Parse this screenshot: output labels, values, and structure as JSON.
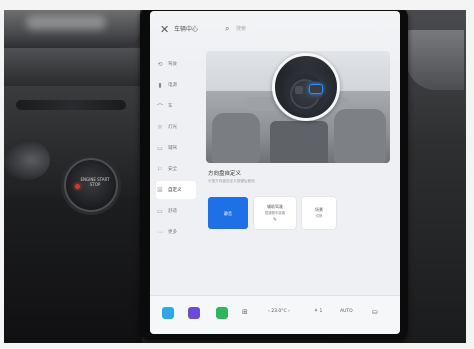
{
  "app": {
    "close_glyph": "✕",
    "title": "车辆中心",
    "search_glyph": "🔍",
    "search_label": "搜索"
  },
  "sidebar": {
    "items": [
      {
        "label": "驾驶",
        "icon": "steering-icon",
        "glyph": "⟲"
      },
      {
        "label": "电源",
        "icon": "battery-icon",
        "glyph": "▮"
      },
      {
        "label": "车",
        "icon": "car-icon",
        "glyph": "⌒"
      },
      {
        "label": "灯光",
        "icon": "light-icon",
        "glyph": "☼"
      },
      {
        "label": "辅驾",
        "icon": "assist-icon",
        "glyph": "▭"
      },
      {
        "label": "安全",
        "icon": "shield-icon",
        "glyph": "⚐"
      },
      {
        "label": "自定义",
        "icon": "custom-icon",
        "glyph": "☒"
      },
      {
        "label": "舒适",
        "icon": "comfort-icon",
        "glyph": "▭"
      },
      {
        "label": "更多",
        "icon": "more-icon",
        "glyph": "⋯"
      }
    ],
    "active_index": 6
  },
  "section": {
    "title": "方向盘自定义",
    "subtitle": "长按方向盘自定义按键后使用"
  },
  "options": [
    {
      "label": "静音",
      "sub": "",
      "selected": true
    },
    {
      "label": "辅助驾驶",
      "sub": "限速跟车距离",
      "selected": false,
      "edit": "✎"
    },
    {
      "label": "场景",
      "sub": "切换",
      "selected": false
    }
  ],
  "dock": {
    "temperature": "‹ 23.0°C ›",
    "fan": "⚘ 1",
    "mode": "AUTO",
    "apps": [
      {
        "name": "map-app-icon",
        "color": "#2da7e6"
      },
      {
        "name": "media-app-icon",
        "color": "#6a4bd8"
      },
      {
        "name": "phone-app-icon",
        "color": "#2fb55a"
      }
    ],
    "grid_glyph": "⊞",
    "seat_glyph": "⛀"
  },
  "start_button": {
    "text": "ENGINE START STOP"
  },
  "colors": {
    "accent": "#1f6fe6",
    "screen_bg": "#eef0f3"
  }
}
